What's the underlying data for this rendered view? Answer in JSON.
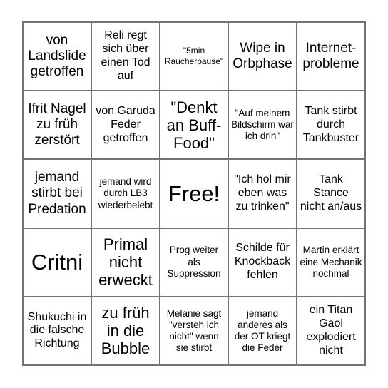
{
  "card": {
    "type": "bingo-card",
    "columns": 5,
    "rows": 5,
    "free_space_index": 12,
    "border_color": "#737373",
    "background_color": "#ffffff",
    "text_color": "#000000",
    "cells": [
      {
        "text": "von Landslide getroffen",
        "size": "md",
        "free": false
      },
      {
        "text": "Reli regt sich über einen Tod auf",
        "size": "sm",
        "free": false
      },
      {
        "text": "\"5min Raucherpause\"",
        "size": "xxs",
        "free": false
      },
      {
        "text": "Wipe in Orbphase",
        "size": "md",
        "free": false
      },
      {
        "text": "Internet-probleme",
        "size": "md",
        "free": false
      },
      {
        "text": "Ifrit Nagel zu früh zerstört",
        "size": "md",
        "free": false
      },
      {
        "text": "von Garuda Feder getroffen",
        "size": "sm",
        "free": false
      },
      {
        "text": "\"Denkt an Buff-Food\"",
        "size": "lg",
        "free": false
      },
      {
        "text": "\"Auf meinem Bildschirm war ich drin\"",
        "size": "xs",
        "free": false
      },
      {
        "text": "Tank stirbt durch Tankbuster",
        "size": "sm",
        "free": false
      },
      {
        "text": "jemand stirbt bei Predation",
        "size": "md",
        "free": false
      },
      {
        "text": "jemand wird durch LB3 wiederbelebt",
        "size": "xs",
        "free": false
      },
      {
        "text": "Free!",
        "size": "xl",
        "free": true
      },
      {
        "text": "\"Ich hol mir eben was zu trinken\"",
        "size": "sm",
        "free": false
      },
      {
        "text": "Tank Stance nicht an/aus",
        "size": "sm",
        "free": false
      },
      {
        "text": "Critni",
        "size": "xl",
        "free": false
      },
      {
        "text": "Primal nicht erweckt",
        "size": "lg",
        "free": false
      },
      {
        "text": "Prog weiter als Suppression",
        "size": "xs",
        "free": false
      },
      {
        "text": "Schilde für Knockback fehlen",
        "size": "sm",
        "free": false
      },
      {
        "text": "Martin erklärt eine Mechanik nochmal",
        "size": "xs",
        "free": false
      },
      {
        "text": "Shukuchi in die falsche Richtung",
        "size": "sm",
        "free": false
      },
      {
        "text": "zu früh in die Bubble",
        "size": "lg",
        "free": false
      },
      {
        "text": "Melanie sagt \"versteh ich nicht\" wenn sie stirbt",
        "size": "xs",
        "free": false
      },
      {
        "text": "jemand anderes als der OT kriegt die Feder",
        "size": "xs",
        "free": false
      },
      {
        "text": "ein Titan Gaol explodiert nicht",
        "size": "sm",
        "free": false
      }
    ]
  }
}
